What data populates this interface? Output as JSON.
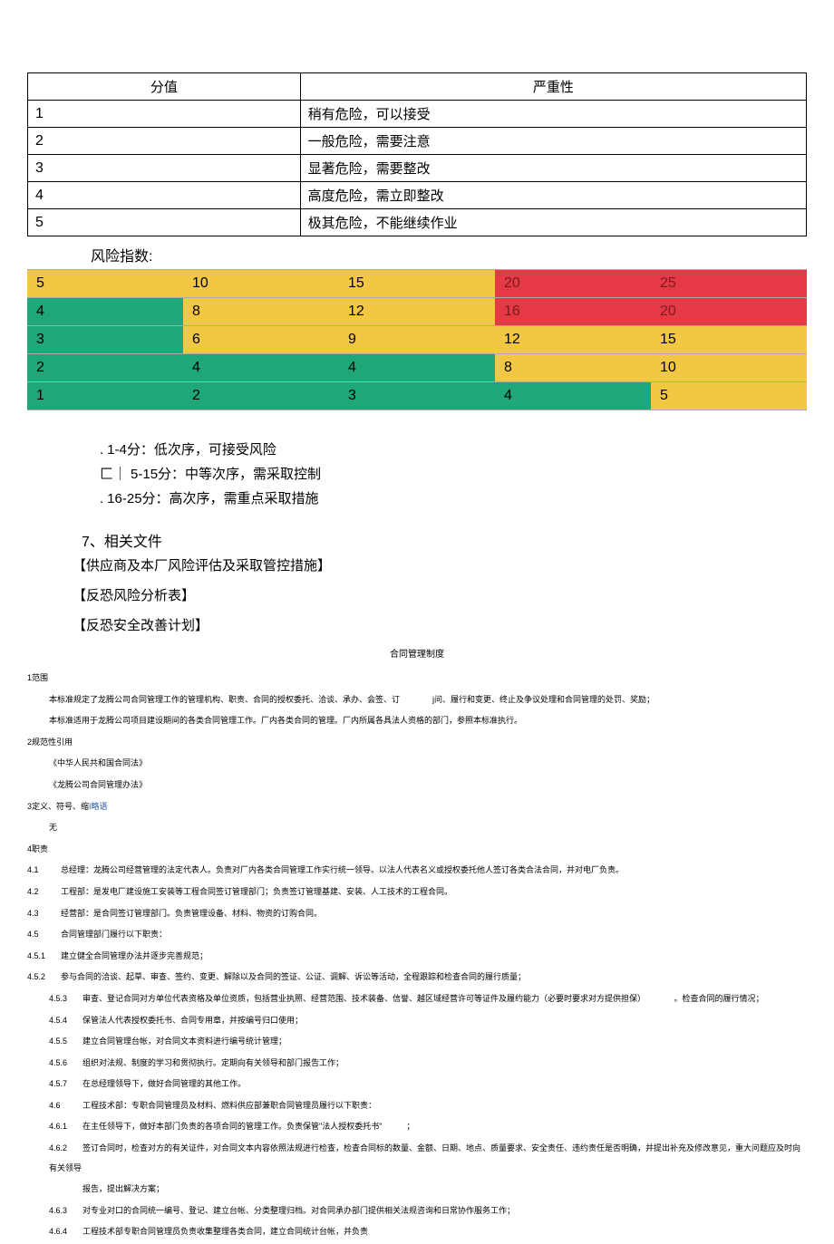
{
  "severity_table": {
    "headers": [
      "分值",
      "严重性"
    ],
    "rows": [
      [
        "1",
        "稍有危险，可以接受"
      ],
      [
        "2",
        "一般危险，需要注意"
      ],
      [
        "3",
        "显著危险，需要整改"
      ],
      [
        "4",
        "高度危险，需立即整改"
      ],
      [
        "5",
        "极其危险，不能继续作业"
      ]
    ]
  },
  "risk_index_label": "风险指数:",
  "chart_data": {
    "type": "heatmap",
    "title": "风险指数",
    "rows": [
      [
        {
          "v": "5",
          "c": "yellow"
        },
        {
          "v": "10",
          "c": "yellow"
        },
        {
          "v": "15",
          "c": "yellow"
        },
        {
          "v": "20",
          "c": "red"
        },
        {
          "v": "25",
          "c": "red"
        }
      ],
      [
        {
          "v": "4",
          "c": "green"
        },
        {
          "v": "8",
          "c": "yellow"
        },
        {
          "v": "12",
          "c": "yellow"
        },
        {
          "v": "16",
          "c": "red"
        },
        {
          "v": "20",
          "c": "red"
        }
      ],
      [
        {
          "v": "3",
          "c": "green"
        },
        {
          "v": "6",
          "c": "yellow"
        },
        {
          "v": "9",
          "c": "yellow"
        },
        {
          "v": "12",
          "c": "yellow"
        },
        {
          "v": "15",
          "c": "yellow"
        }
      ],
      [
        {
          "v": "2",
          "c": "green"
        },
        {
          "v": "4",
          "c": "green"
        },
        {
          "v": "4",
          "c": "green"
        },
        {
          "v": "8",
          "c": "yellow"
        },
        {
          "v": "10",
          "c": "yellow"
        }
      ],
      [
        {
          "v": "1",
          "c": "green"
        },
        {
          "v": "2",
          "c": "green"
        },
        {
          "v": "3",
          "c": "green"
        },
        {
          "v": "4",
          "c": "green"
        },
        {
          "v": "5",
          "c": "yellow"
        }
      ]
    ],
    "legend": [
      {
        "range": "1-4",
        "label": "低次序，可接受风险"
      },
      {
        "range": "5-15",
        "label": "中等次序，需采取控制"
      },
      {
        "range": "16-25",
        "label": "高次序，需重点采取措施"
      }
    ]
  },
  "legend_rows": [
    {
      "prefix": ". ",
      "text": "1-4分：低次序，可接受风险"
    },
    {
      "prefix": "匚｜ ",
      "text": "5-15分：中等次序，需采取控制"
    },
    {
      "prefix": ". ",
      "text": "16-25分：高次序，需重点采取措施"
    }
  ],
  "section7_heading": "7、相关文件",
  "related_docs": [
    "【供应商及本厂风险评估及采取管控措施】",
    "【反恐风险分析表】",
    "【反恐安全改善计划】"
  ],
  "subtitle_center": "合同管理制度",
  "fine_sections": [
    {
      "type": "h",
      "text": "1范围"
    },
    {
      "type": "p",
      "text": "本标准规定了龙腾公司合同管理工作的管理机构、职责、合同的授权委托、洽谈、承办、会签、订　　　　j问、履行和变更、终止及争议处理和合同管理的处罚、奖励；"
    },
    {
      "type": "p",
      "text": "本标准适用于龙腾公司项目建设期间的各类合同管理工作。厂内各类合同的管理。厂内所属各具法人资格的部门，参照本标准执行。"
    },
    {
      "type": "h",
      "text": "2规范性引用"
    },
    {
      "type": "p",
      "text": "《中华人民共和国合同法》"
    },
    {
      "type": "p",
      "text": "《龙腾公司合同管理办法》"
    },
    {
      "type": "h",
      "text_html": "3定义、符号、缩<span class='link'>I略语</span>"
    },
    {
      "type": "p",
      "text": "无"
    },
    {
      "type": "h",
      "text": "4职责"
    },
    {
      "type": "n",
      "num": "4.1",
      "text": "总经理：龙腾公司经营管理的法定代表人。负责对厂内各类合同管理工作实行统一领导。以法人代表名义或授权委托他人签订各类合法合同，并对电厂负责。"
    },
    {
      "type": "n",
      "num": "4.2",
      "text": "工程部：是发电厂建设施工安装等工程合同签订管理部门；负责签订管理基建、安装、人工技术的工程合同。"
    },
    {
      "type": "n",
      "num": "4.3",
      "text": "经营部：是合同签订管理部门。负责管理设备、材料、物资的订购合同。"
    },
    {
      "type": "n",
      "num": "4.5",
      "text": "合同管理部门履行以下职责："
    },
    {
      "type": "n",
      "num": "4.5.1",
      "text": "建立健全合同管理办法并逐步完善规范；"
    },
    {
      "type": "n",
      "num": "4.5.2",
      "text": "参与合同的洽谈、起草、审查、签约、变更、解除以及合同的签证、公证、调解、诉讼等活动，全程跟踪和检查合同的履行质量；"
    },
    {
      "type": "in",
      "num": "4.5.3",
      "text": "审查、登记合同对方单位代表资格及单位资质，包括营业执照、经营范围、技术装备、信誉、越区域经营许可等证件及履约能力（必要时要求对方提供担保）　　　　。检查合同的履行情况；"
    },
    {
      "type": "in",
      "num": "4.5.4",
      "text": "保管法人代表授权委托书、合同专用章，并按编号归口使用；"
    },
    {
      "type": "in",
      "num": "4.5.5",
      "text": "建立合同管理台帐，对合同文本资料进行编号统计管理；"
    },
    {
      "type": "in",
      "num": "4.5.6",
      "text": "组织对法规、制度的学习和贯彻执行。定期向有关领导和部门报告工作；"
    },
    {
      "type": "in",
      "num": "4.5.7",
      "text": "在总经理领导下，做好合同管理的其他工作。"
    },
    {
      "type": "in",
      "num": "4.6",
      "text": "工程技术部：专职合同管理员及材料、燃料供应部兼职合同管理员履行以下职责："
    },
    {
      "type": "in",
      "num": "4.6.1",
      "text": "在主任领导下，做好本部门负责的各项合同的管理工作。负责保管\"法人授权委托书\"　　　；"
    },
    {
      "type": "in",
      "num": "4.6.2",
      "text": "签订合同时，检查对方的有关证件，对合同文本内容依照法规进行检查，检查合同标的数量、金额、日期、地点、质量要求、安全责任、违约责任是否明确，并提出补充及修改意见，重大问题应及时向有关领导"
    },
    {
      "type": "in",
      "num": "",
      "text": "报告，提出解决方案；"
    },
    {
      "type": "in",
      "num": "4.6.3",
      "text": "对专业对口的合同统一编号、登记、建立台帐、分类整理归档。对合同承办部门提供相关法规咨询和日常协作服务工作；"
    },
    {
      "type": "in",
      "num": "4.6.4",
      "text": "工程技术部专职合同管理员负责收集整理各类合同，建立合同统计台帐，并负责"
    }
  ]
}
